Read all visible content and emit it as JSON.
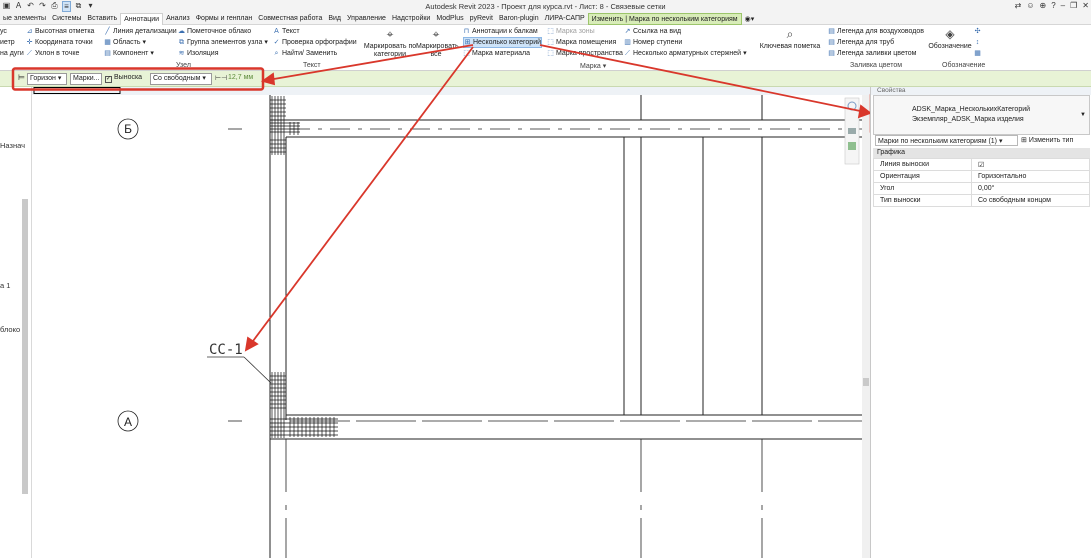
{
  "titlebar": {
    "title": "Autodesk Revit 2023 - Проект для курса.rvt - Лист: 8 - Связевые сетки",
    "qat_icons": [
      "revit-logo-icon",
      "text-icon",
      "undo-icon",
      "redo-icon",
      "print-icon",
      "thin-lines-icon",
      "close-windows-icon",
      "dropdown-icon"
    ]
  },
  "tabs": [
    "ые элементы",
    "Системы",
    "Вставить",
    "Аннотации",
    "Анализ",
    "Формы и генплан",
    "Совместная работа",
    "Вид",
    "Управление",
    "Надстройки",
    "ModPlus",
    "pyRevit",
    "Baron-plugin",
    "ЛИРА-САПР",
    "Изменить | Марка по нескольким категориям"
  ],
  "ribbon": {
    "dimension_col": [
      "ус",
      "иетр",
      "на дуги"
    ],
    "spot_col": [
      "Высотная отметка",
      "Координата точки",
      "Уклон  в точке"
    ],
    "detail_col": [
      "Линия детализации",
      "Область",
      "Компонент"
    ],
    "detail2_col": [
      "Пометочное облако",
      "Группа элементов узла",
      "Изоляция"
    ],
    "detail_panel": "Узел",
    "text_col": [
      "Текст",
      "Проверка  орфографии",
      "Найти/ Заменить"
    ],
    "text_panel": "Текст",
    "tag_by_category": "Маркировать по категории",
    "tag_all": "Маркировать все",
    "tag_col1": [
      "Аннотации к балкам",
      "Несколько категорий",
      "Марка материала"
    ],
    "tag_col2": [
      "Марка зоны",
      "Марка помещения",
      "Марка пространства"
    ],
    "tag_col3": [
      "Ссылка на вид",
      "Номер  ступени",
      "Несколько  арматурных стержней"
    ],
    "tag_panel": "Марка",
    "keynote": "Ключевая пометка",
    "legend_col": [
      "Легенда для воздуховодов",
      "Легенда для труб",
      "Легенда заливки цветом"
    ],
    "color_fill_panel": "Заливка цветом",
    "symbol": "Обозначение",
    "symbol_panel": "Обозначение"
  },
  "optbar": {
    "orientation": "Горизон",
    "tag_type": "Марки...",
    "leader_label": "Выноска",
    "leader_type": "Со свободным",
    "length": "12,7 мм"
  },
  "view": {
    "left_texts": [
      "Назнач",
      "а 1",
      "блоко"
    ],
    "grid_b": "Б",
    "grid_a": "А",
    "tag_label": "СС-1"
  },
  "properties": {
    "header": "Свойства",
    "type_line1": "ADSK_Марка_НесколькихКатегорий",
    "type_line2": "Экземпляр_ADSK_Марка изделия",
    "filter": "Марки по нескольким категориям (1)",
    "edit_type": "Изменить тип",
    "group": "Графика",
    "rows": [
      {
        "key": "Линия выноски",
        "value": "☑"
      },
      {
        "key": "Ориентация",
        "value": "Горизонтально"
      },
      {
        "key": "Угол",
        "value": "0,00°"
      },
      {
        "key": "Тип выноски",
        "value": "Со свободным концом"
      }
    ]
  },
  "colors": {
    "annotation_red": "#d9372b",
    "contextual_tab": "#d8ecb8",
    "options_bar": "#e8f3d6"
  }
}
